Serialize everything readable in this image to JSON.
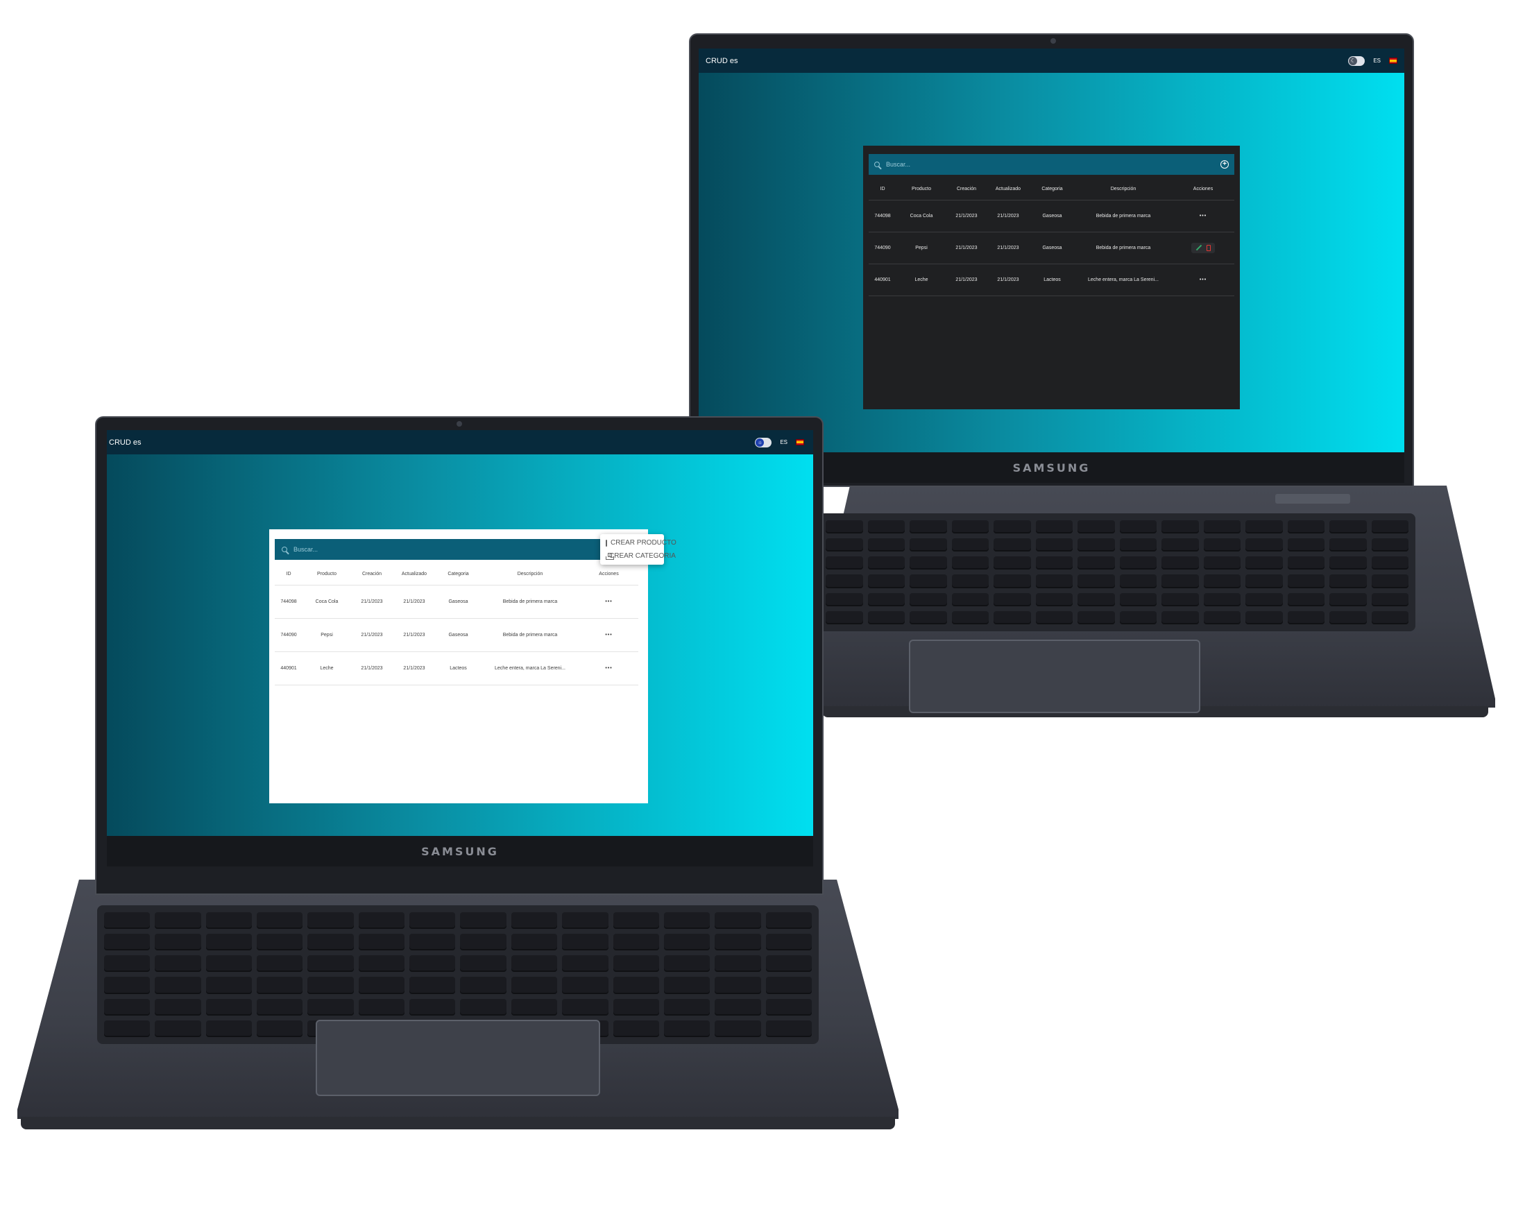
{
  "device": {
    "brand": "SAMSUNG"
  },
  "app": {
    "title": "CRUD es",
    "language": "ES",
    "search_placeholder": "Buscar...",
    "columns": [
      "ID",
      "Producto",
      "Creación",
      "Actualizado",
      "Categoria",
      "Descripción",
      "Acciones"
    ],
    "rows": [
      {
        "id": "744098",
        "producto": "Coca Cola",
        "creacion": "21/1/2023",
        "actualizado": "21/1/2023",
        "categoria": "Gaseosa",
        "descripcion": "Bebida de primera marca",
        "acciones": "•••"
      },
      {
        "id": "744090",
        "producto": "Pepsi",
        "creacion": "21/1/2023",
        "actualizado": "21/1/2023",
        "categoria": "Gaseosa",
        "descripcion": "Bebida de primera marca",
        "acciones": "•••"
      },
      {
        "id": "440901",
        "producto": "Leche",
        "creacion": "21/1/2023",
        "actualizado": "21/1/2023",
        "categoria": "Lacteos",
        "descripcion": "Leche entera, marca La Sereni...",
        "acciones": "•••"
      }
    ],
    "add_menu": {
      "create_product": "CREAR PRODUCTO",
      "create_category": "CREAR CATEGORIA"
    }
  },
  "icons": {
    "search": "search-icon",
    "add": "add-circle-icon",
    "theme_dark": "moon-icon",
    "theme_light": "sun-icon",
    "flag": "spain-flag-icon",
    "edit": "pencil-icon",
    "delete": "trash-icon",
    "more": "more-horizontal-icon"
  },
  "colors": {
    "appbar": "#072a3c",
    "searchbar": "#0b5f78",
    "gradient_start": "#054a5c",
    "gradient_end": "#00dff0",
    "dark_panel": "#1f2022",
    "light_panel": "#ffffff",
    "edit": "#34a86a",
    "delete": "#e53935"
  }
}
